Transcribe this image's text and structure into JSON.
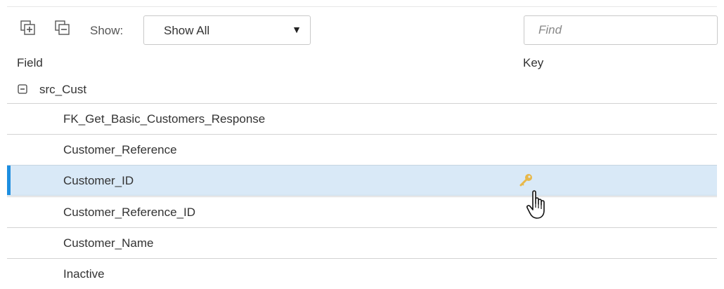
{
  "toolbar": {
    "expand_icon": "expand-all-icon",
    "collapse_icon": "collapse-all-icon",
    "show_label": "Show:",
    "show_selected": "Show All",
    "find_placeholder": "Find"
  },
  "columns": {
    "field": "Field",
    "key": "Key"
  },
  "group": {
    "label": "src_Cust",
    "icon": "collapse-icon"
  },
  "rows": [
    {
      "name": "FK_Get_Basic_Customers_Response",
      "key": false,
      "selected": false
    },
    {
      "name": "Customer_Reference",
      "key": false,
      "selected": false
    },
    {
      "name": "Customer_ID",
      "key": true,
      "selected": true
    },
    {
      "name": "Customer_Reference_ID",
      "key": false,
      "selected": false
    },
    {
      "name": "Customer_Name",
      "key": false,
      "selected": false
    },
    {
      "name": "Inactive",
      "key": false,
      "selected": false
    }
  ],
  "colors": {
    "selected_row": "#d9e9f7",
    "selection_bar": "#1d8ee0",
    "key_icon": "#e8b84a"
  }
}
